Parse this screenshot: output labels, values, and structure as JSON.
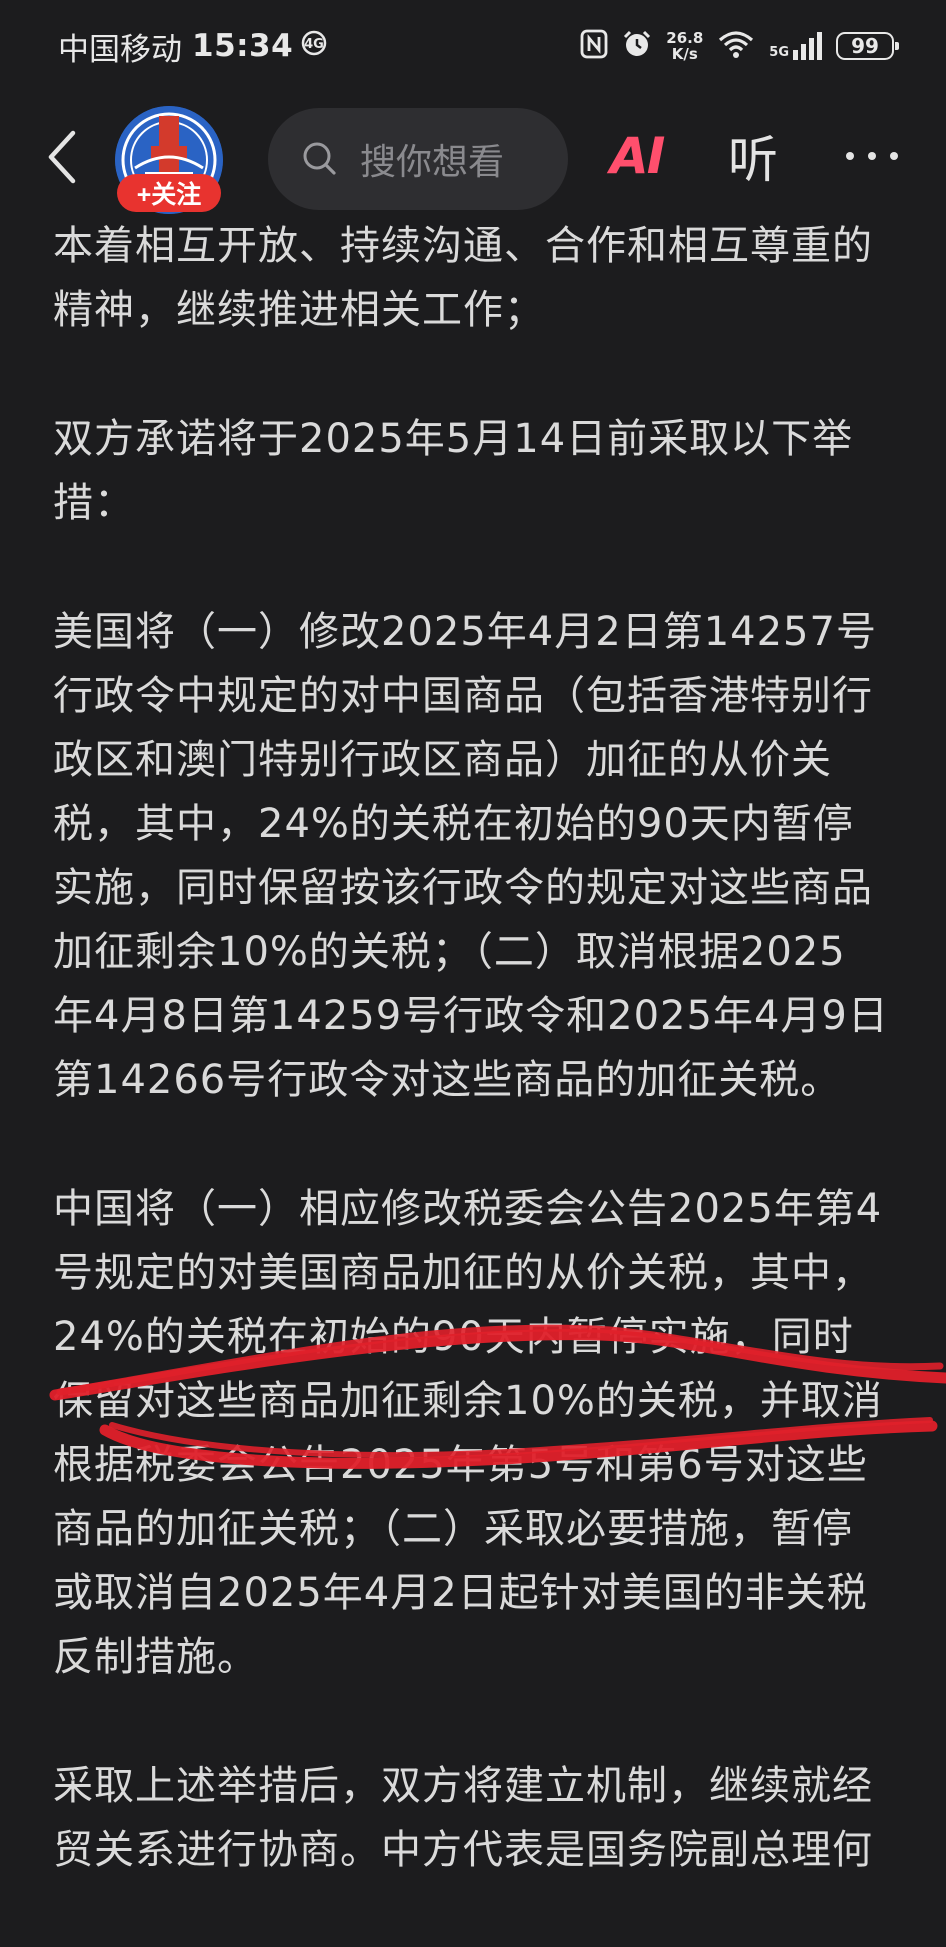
{
  "status_bar": {
    "carrier": "中国移动",
    "time": "15:34",
    "net_speed_value": "26.8",
    "net_speed_unit": "K/s",
    "network_label": "5G",
    "battery": "99"
  },
  "nav": {
    "follow_label": "+关注",
    "search_placeholder": "搜你想看",
    "ai_label": "AI",
    "listen_label": "听"
  },
  "article": {
    "paragraphs": [
      {
        "lines": [
          "本着相互开放、持续沟通、合作和相互尊重的",
          "精神，继续推进相关工作；"
        ]
      },
      {
        "lines": [
          "双方承诺将于2025年5月14日前采取以下举",
          "措："
        ]
      },
      {
        "lines": [
          "美国将（一）修改2025年4月2日第14257号",
          "行政令中规定的对中国商品（包括香港特别行",
          "政区和澳门特别行政区商品）加征的从价关",
          "税，其中，24%的关税在初始的90天内暂停",
          "实施，同时保留按该行政令的规定对这些商品",
          "加征剩余10%的关税；（二）取消根据2025",
          "年4月8日第14259号行政令和2025年4月9日",
          "第14266号行政令对这些商品的加征关税。"
        ]
      },
      {
        "lines": [
          "中国将（一）相应修改税委会公告2025年第4",
          "号规定的对美国商品加征的从价关税，其中，",
          "24%的关税在初始的90天内暂停实施，同时",
          "保留对这些商品加征剩余10%的关税，并取消",
          "根据税委会公告2025年第5号和第6号对这些",
          "商品的加征关税；（二）采取必要措施，暂停",
          "或取消自2025年4月2日起针对美国的非关税",
          "反制措施。"
        ]
      },
      {
        "lines": [
          "采取上述举措后，双方将建立机制，继续就经",
          "贸关系进行协商。中方代表是国务院副总理何"
        ]
      }
    ]
  },
  "colors": {
    "background": "#1c1c1e",
    "text": "#dadada",
    "follow_button": "#e8332f",
    "ai_accent": "#ff4f6d",
    "annotation_stroke": "#e0202a"
  }
}
